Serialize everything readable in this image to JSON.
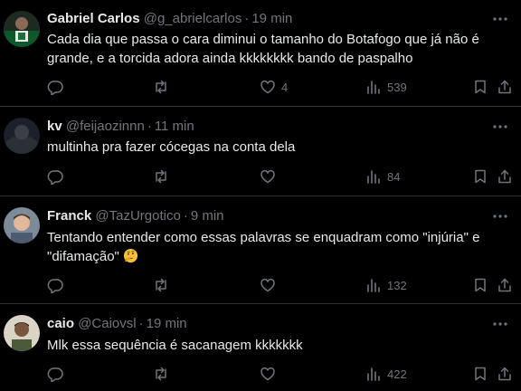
{
  "tweets": [
    {
      "name": "Gabriel Carlos",
      "handle": "@g_abrielcarlos",
      "sep": "·",
      "time": "19 min",
      "text": "Cada dia que passa o cara diminui o tamanho do Botafogo que já não é grande, e a torcida adora ainda kkkkkkkk bando de paspalho",
      "likes": "4",
      "views": "539"
    },
    {
      "name": "kv",
      "handle": "@feijaozinnn",
      "sep": "·",
      "time": "11 min",
      "text": "multinha pra fazer cócegas na conta dela",
      "likes": "",
      "views": "84"
    },
    {
      "name": "Franck",
      "handle": "@TazUrgotico",
      "sep": "·",
      "time": "9 min",
      "text": "Tentando entender como essas palavras se enquadram como \"injúria\" e \"difamação\"",
      "likes": "",
      "views": "132"
    },
    {
      "name": "caio",
      "handle": "@Caiovsl",
      "sep": "·",
      "time": "19 min",
      "text": "Mlk essa sequência é sacanagem kkkkkkk",
      "likes": "",
      "views": "422"
    }
  ],
  "icons": [
    "more-icon",
    "reply-icon",
    "retweet-icon",
    "like-icon",
    "views-icon",
    "bookmark-icon",
    "share-icon"
  ],
  "colors": {
    "background": "#000000",
    "text": "#e7e9ea",
    "muted": "#71767b",
    "divider": "#2f3336"
  }
}
